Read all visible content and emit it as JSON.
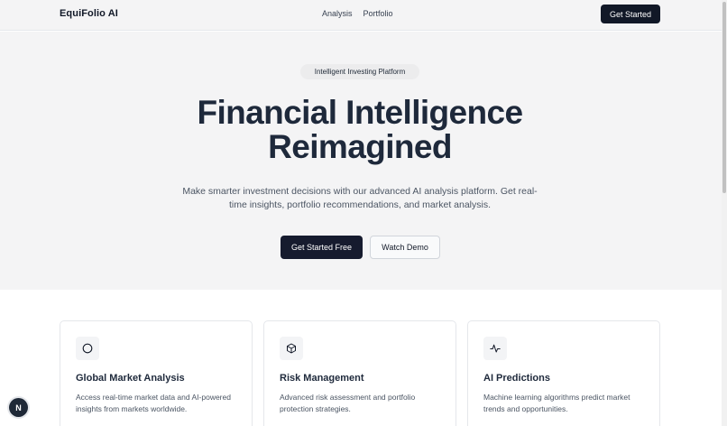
{
  "header": {
    "brand": "EquiFolio AI",
    "nav": [
      "Analysis",
      "Portfolio"
    ],
    "cta_label": "Get Started"
  },
  "hero": {
    "badge": "Intelligent Investing Platform",
    "headline_line1": "Financial Intelligence",
    "headline_line2": "Reimagined",
    "subtext": "Make smarter investment decisions with our advanced AI analysis platform. Get real-time insights, portfolio recommendations, and market analysis.",
    "primary_cta": "Get Started Free",
    "secondary_cta": "Watch Demo"
  },
  "features": [
    {
      "icon": "circle-icon",
      "title": "Global Market Analysis",
      "description": "Access real-time market data and AI-powered insights from markets worldwide."
    },
    {
      "icon": "box-icon",
      "title": "Risk Management",
      "description": "Advanced risk assessment and portfolio protection strategies."
    },
    {
      "icon": "activity-icon",
      "title": "AI Predictions",
      "description": "Machine learning algorithms predict market trends and opportunities."
    }
  ],
  "floating_badge": "N"
}
